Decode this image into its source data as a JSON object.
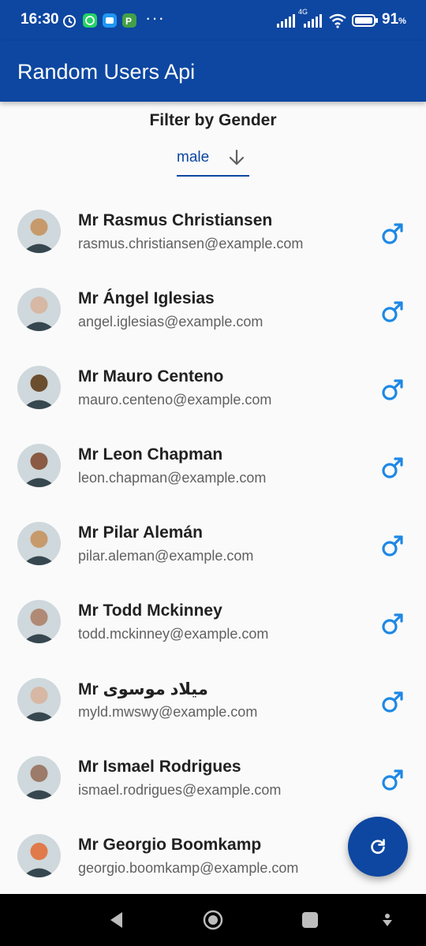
{
  "status_bar": {
    "time": "16:30",
    "more": "···",
    "battery_percent": "91",
    "percent_sign": "%",
    "network": "4G"
  },
  "app_bar": {
    "title": "Random Users Api"
  },
  "filter": {
    "title": "Filter by Gender",
    "selected": "male"
  },
  "users": [
    {
      "name": "Mr Rasmus Christiansen",
      "email": "rasmus.christiansen@example.com",
      "gender_icon": "male-icon",
      "avatar_color": "#c79a6b"
    },
    {
      "name": "Mr Ángel Iglesias",
      "email": "angel.iglesias@example.com",
      "gender_icon": "male-icon",
      "avatar_color": "#d6b8a4"
    },
    {
      "name": "Mr Mauro Centeno",
      "email": "mauro.centeno@example.com",
      "gender_icon": "male-icon",
      "avatar_color": "#6b4e2e"
    },
    {
      "name": "Mr Leon Chapman",
      "email": "leon.chapman@example.com",
      "gender_icon": "male-icon",
      "avatar_color": "#8a5a44"
    },
    {
      "name": "Mr Pilar Alemán",
      "email": "pilar.aleman@example.com",
      "gender_icon": "male-icon",
      "avatar_color": "#c79a6b"
    },
    {
      "name": "Mr Todd Mckinney",
      "email": "todd.mckinney@example.com",
      "gender_icon": "male-icon",
      "avatar_color": "#b08a74"
    },
    {
      "name": "Mr میلاد موسوی",
      "email": "myld.mwswy@example.com",
      "gender_icon": "male-icon",
      "avatar_color": "#d6b8a4"
    },
    {
      "name": "Mr Ismael Rodrigues",
      "email": "ismael.rodrigues@example.com",
      "gender_icon": "male-icon",
      "avatar_color": "#9c7b6a"
    },
    {
      "name": "Mr Georgio Boomkamp",
      "email": "georgio.boomkamp@example.com",
      "gender_icon": "male-icon",
      "avatar_color": "#e07a4a"
    }
  ],
  "fab": {
    "icon": "refresh-icon"
  },
  "colors": {
    "primary": "#0d47a1",
    "accent_icon": "#1e88e5",
    "background": "#fafafa"
  }
}
